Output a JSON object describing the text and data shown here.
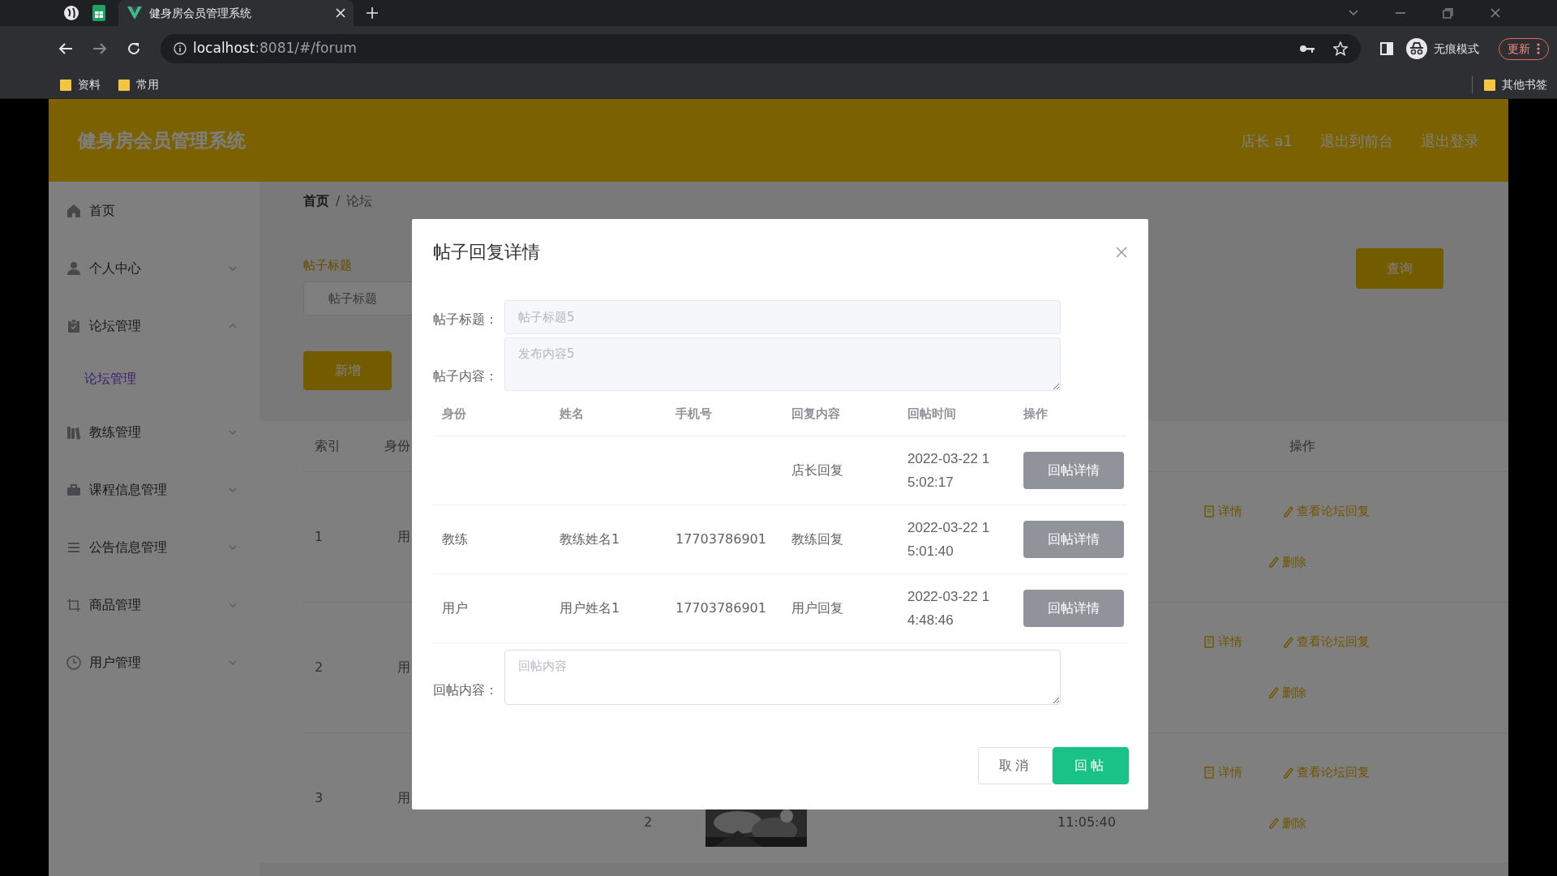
{
  "browser": {
    "tabs": [
      {
        "title": "健身房会员管理系统",
        "selected": true
      }
    ],
    "url": {
      "host": "localhost",
      "rest": ":8081/#/forum"
    },
    "profile_label": "无痕模式",
    "update_button": "更新",
    "bookmarks": [
      "资料",
      "常用"
    ],
    "other_bookmarks": "其他书签"
  },
  "app": {
    "title": "健身房会员管理系统",
    "header_links": [
      "店长 a1",
      "退出到前台",
      "退出登录"
    ],
    "sidebar": [
      {
        "label": "首页",
        "kind": "link"
      },
      {
        "label": "个人中心",
        "kind": "menu",
        "expanded": false
      },
      {
        "label": "论坛管理",
        "kind": "menu",
        "expanded": true,
        "children": [
          {
            "label": "论坛管理",
            "selected": true
          }
        ]
      },
      {
        "label": "教练管理",
        "kind": "menu",
        "expanded": false
      },
      {
        "label": "课程信息管理",
        "kind": "menu",
        "expanded": false
      },
      {
        "label": "公告信息管理",
        "kind": "menu",
        "expanded": false
      },
      {
        "label": "商品管理",
        "kind": "menu",
        "expanded": false
      },
      {
        "label": "用户管理",
        "kind": "menu",
        "expanded": false
      }
    ],
    "breadcrumb": {
      "items": [
        "首页",
        "论坛"
      ],
      "separator": "/"
    },
    "search": {
      "label": "帖子标题",
      "placeholder": "帖子标题"
    },
    "search_button": "查询",
    "add_button": "新增",
    "table": {
      "columns": [
        "索引",
        "身份",
        "操作"
      ],
      "rows": [
        {
          "index": "1",
          "column_2": "用",
          "actions": [
            "详情",
            "查看论坛回复",
            "删除"
          ]
        },
        {
          "index": "2",
          "column_2": "用",
          "actions": [
            "详情",
            "查看论坛回复",
            "删除"
          ]
        },
        {
          "index": "3",
          "column_2": "用",
          "column_3": "2",
          "time": "11:05:40",
          "actions": [
            "详情",
            "查看论坛回复",
            "删除"
          ]
        }
      ]
    }
  },
  "dialog": {
    "title": "帖子回复详情",
    "fields": [
      {
        "kind": "input",
        "label": "帖子标题：",
        "value": "帖子标题5"
      },
      {
        "kind": "textarea",
        "label": "帖子内容：",
        "value": "发布内容5"
      }
    ],
    "replies": {
      "columns": [
        "身份",
        "姓名",
        "手机号",
        "回复内容",
        "回帖时间",
        "操作"
      ],
      "rows": [
        {
          "content": "店长回复",
          "time": "2022-03-22 15:02:17",
          "action": "回帖详情"
        },
        {
          "identity": "教练",
          "name": "教练姓名1",
          "phone": "17703786901",
          "content": "教练回复",
          "time": "2022-03-22 15:01:40",
          "action": "回帖详情"
        },
        {
          "identity": "用户",
          "name": "用户姓名1",
          "phone": "17703786901",
          "content": "用户回复",
          "time": "2022-03-22 14:48:46",
          "action": "回帖详情"
        }
      ]
    },
    "reply_field": {
      "label": "回帖内容：",
      "placeholder": "回帖内容"
    },
    "buttons": [
      {
        "kind": "cancel",
        "label": "取消"
      },
      {
        "kind": "primary",
        "label": "回帖"
      }
    ]
  }
}
